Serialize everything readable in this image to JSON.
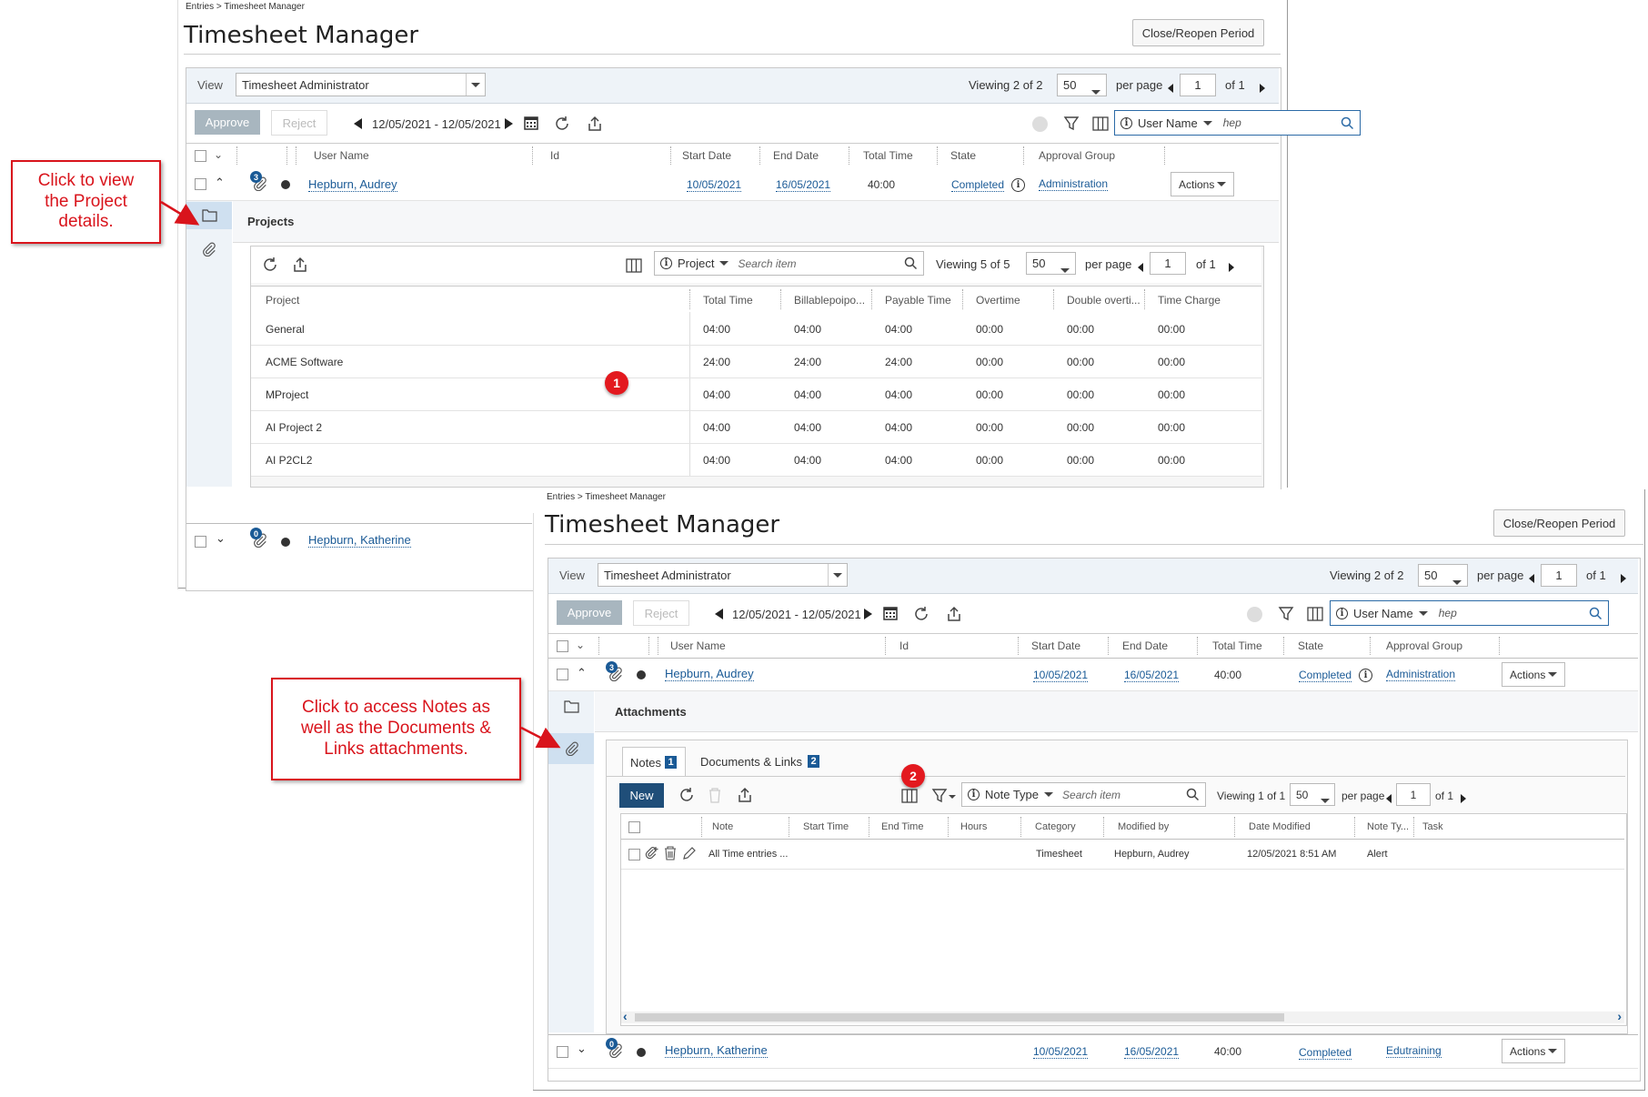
{
  "screen1": {
    "breadcrumb": "Entries > Timesheet Manager",
    "title": "Timesheet Manager",
    "close_reopen": "Close/Reopen Period",
    "view_label": "View",
    "view_value": "Timesheet Administrator",
    "viewing_prefix": "Viewing",
    "viewing_count": "2 of 2",
    "per_page_value": "50",
    "per_page_label": "per page",
    "page_value": "1",
    "of_pages": "of 1",
    "approve": "Approve",
    "reject": "Reject",
    "date_range": "12/05/2021 - 12/05/2021",
    "search_field": "User Name",
    "search_value": "hep",
    "columns": [
      "User Name",
      "Id",
      "Start Date",
      "End Date",
      "Total Time",
      "State",
      "Approval Group"
    ],
    "row1": {
      "badge": "3",
      "user": "Hepburn, Audrey",
      "start": "10/05/2021",
      "end": "16/05/2021",
      "total": "40:00",
      "state": "Completed",
      "group": "Administration",
      "actions": "Actions"
    },
    "section_title": "Projects",
    "projects": {
      "search_field": "Project",
      "search_placeholder": "Search item",
      "viewing_count": "5 of 5",
      "per_page_value": "50",
      "page_value": "1",
      "of_pages": "of 1",
      "columns": [
        "Project",
        "Total Time",
        "Billablepoipo...",
        "Payable Time",
        "Overtime",
        "Double overti...",
        "Time Charge"
      ],
      "rows": [
        [
          "General",
          "04:00",
          "04:00",
          "04:00",
          "00:00",
          "00:00",
          "00:00"
        ],
        [
          "ACME Software",
          "24:00",
          "24:00",
          "24:00",
          "00:00",
          "00:00",
          "00:00"
        ],
        [
          "MProject",
          "04:00",
          "04:00",
          "04:00",
          "00:00",
          "00:00",
          "00:00"
        ],
        [
          "AI Project 2",
          "04:00",
          "04:00",
          "04:00",
          "00:00",
          "00:00",
          "00:00"
        ],
        [
          "AI P2CL2",
          "04:00",
          "04:00",
          "04:00",
          "00:00",
          "00:00",
          "00:00"
        ]
      ]
    },
    "row2": {
      "badge": "0",
      "user": "Hepburn, Katherine"
    }
  },
  "screen2": {
    "breadcrumb": "Entries > Timesheet Manager",
    "title": "Timesheet Manager",
    "close_reopen": "Close/Reopen Period",
    "view_label": "View",
    "view_value": "Timesheet Administrator",
    "viewing_prefix": "Viewing",
    "viewing_count": "2 of 2",
    "per_page_value": "50",
    "per_page_label": "per page",
    "page_value": "1",
    "of_pages": "of 1",
    "approve": "Approve",
    "reject": "Reject",
    "date_range": "12/05/2021 - 12/05/2021",
    "search_field": "User Name",
    "search_value": "hep",
    "columns": [
      "User Name",
      "Id",
      "Start Date",
      "End Date",
      "Total Time",
      "State",
      "Approval Group"
    ],
    "row1": {
      "badge": "3",
      "user": "Hepburn, Audrey",
      "start": "10/05/2021",
      "end": "16/05/2021",
      "total": "40:00",
      "state": "Completed",
      "group": "Administration",
      "actions": "Actions"
    },
    "section_title": "Attachments",
    "tabs": {
      "notes": "Notes",
      "notes_count": "1",
      "docs": "Documents & Links",
      "docs_count": "2"
    },
    "notes": {
      "new_button": "New",
      "search_field": "Note Type",
      "search_placeholder": "Search item",
      "viewing_count": "1 of 1",
      "per_page_value": "50",
      "page_value": "1",
      "of_pages": "of 1",
      "columns": [
        "Note",
        "Start Time",
        "End Time",
        "Hours",
        "Category",
        "Modified by",
        "Date Modified",
        "Note Ty...",
        "Task"
      ],
      "row": {
        "note": "All Time entries ...",
        "category": "Timesheet",
        "modified_by": "Hepburn, Audrey",
        "date_modified": "12/05/2021 8:51 AM",
        "note_type": "Alert"
      }
    },
    "row2": {
      "badge": "0",
      "user": "Hepburn, Katherine",
      "start": "10/05/2021",
      "end": "16/05/2021",
      "total": "40:00",
      "state": "Completed",
      "group": "Edutraining",
      "actions": "Actions"
    }
  },
  "callouts": {
    "projects": "Click to view the Project details.",
    "attachments": "Click to access Notes as well as the Documents & Links attachments."
  },
  "markers": {
    "one": "1",
    "two": "2"
  },
  "colors": {
    "accent": "#1a5a96",
    "callout": "#d9141c",
    "marker": "#e3191f",
    "approve": "#a8b6bf"
  }
}
